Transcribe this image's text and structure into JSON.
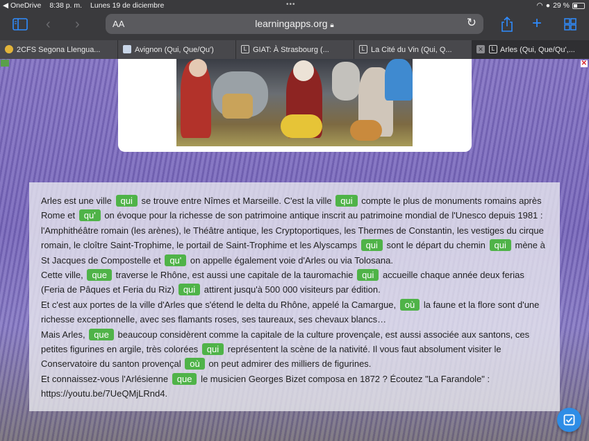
{
  "status_bar": {
    "back_app": "◀ OneDrive",
    "time": "8:38 p. m.",
    "date": "Lunes 19 de diciembre",
    "battery": "29 %"
  },
  "toolbar": {
    "aa_label": "AA",
    "url": "learningapps.org"
  },
  "tabs": [
    {
      "label": "2CFS Segona Llengua..."
    },
    {
      "label": "Avignon (Qui, Que/Qu')"
    },
    {
      "label": "GIAT: À Strasbourg (..."
    },
    {
      "label": "La Cité du Vin (Qui, Q..."
    },
    {
      "label": "Arles (Qui, Que/Qu',..."
    }
  ],
  "text": {
    "p1": [
      "Arles est une ville ",
      {
        "chip": "qui"
      },
      " se trouve entre Nîmes et Marseille. C'est la ville ",
      {
        "chip": "qui"
      },
      " compte le plus de monuments romains après Rome et ",
      {
        "chip": "qu'"
      },
      " on évoque pour la richesse de son patrimoine antique inscrit au patrimoine mondial de l'Unesco depuis 1981 : l'Amphithéâtre romain (les arènes), le Théâtre antique, les Cryptoportiques, les Thermes de Constantin, les vestiges du cirque romain, le cloître Saint-Trophime, le portail de Saint-Trophime et les Alyscamps ",
      {
        "chip": "qui"
      },
      " sont le départ du chemin ",
      {
        "chip": "qui"
      },
      " mène à St Jacques de Compostelle et ",
      {
        "chip": "qu'"
      },
      " on appelle également voie d'Arles ou via Tolosana."
    ],
    "p2": [
      "Cette ville, ",
      {
        "chip": "que"
      },
      " traverse le Rhône, est aussi une capitale de la tauromachie ",
      {
        "chip": "qui"
      },
      " accueille chaque année deux ferias (Feria de Pâques et Feria du Riz) ",
      {
        "chip": "qui"
      },
      " attirent jusqu'à 500 000 visiteurs par édition."
    ],
    "p3": [
      "Et c'est aux portes de la ville d'Arles que s'étend le delta du Rhône, appelé la Camargue, ",
      {
        "chip": "où"
      },
      " la faune et la flore sont d'une richesse exceptionnelle, avec ses flamants roses, ses taureaux, ses chevaux blancs…"
    ],
    "p4": [
      "Mais Arles, ",
      {
        "chip": "que"
      },
      " beaucoup considèrent comme la capitale de la culture provençale, est aussi associée aux santons, ces petites figurines en argile, très colorées ",
      {
        "chip": "qui"
      },
      " représentent la scène de la nativité. Il vous faut absolument visiter le Conservatoire du santon provençal ",
      {
        "chip": "où"
      },
      " on peut admirer des milliers de figurines."
    ],
    "p5": [
      "Et connaissez-vous l'Arlésienne ",
      {
        "chip": "que"
      },
      " le musicien Georges Bizet composa en 1872 ? Écoutez \"La Farandole\" : https://youtu.be/7UeQMjLRnd4."
    ]
  }
}
